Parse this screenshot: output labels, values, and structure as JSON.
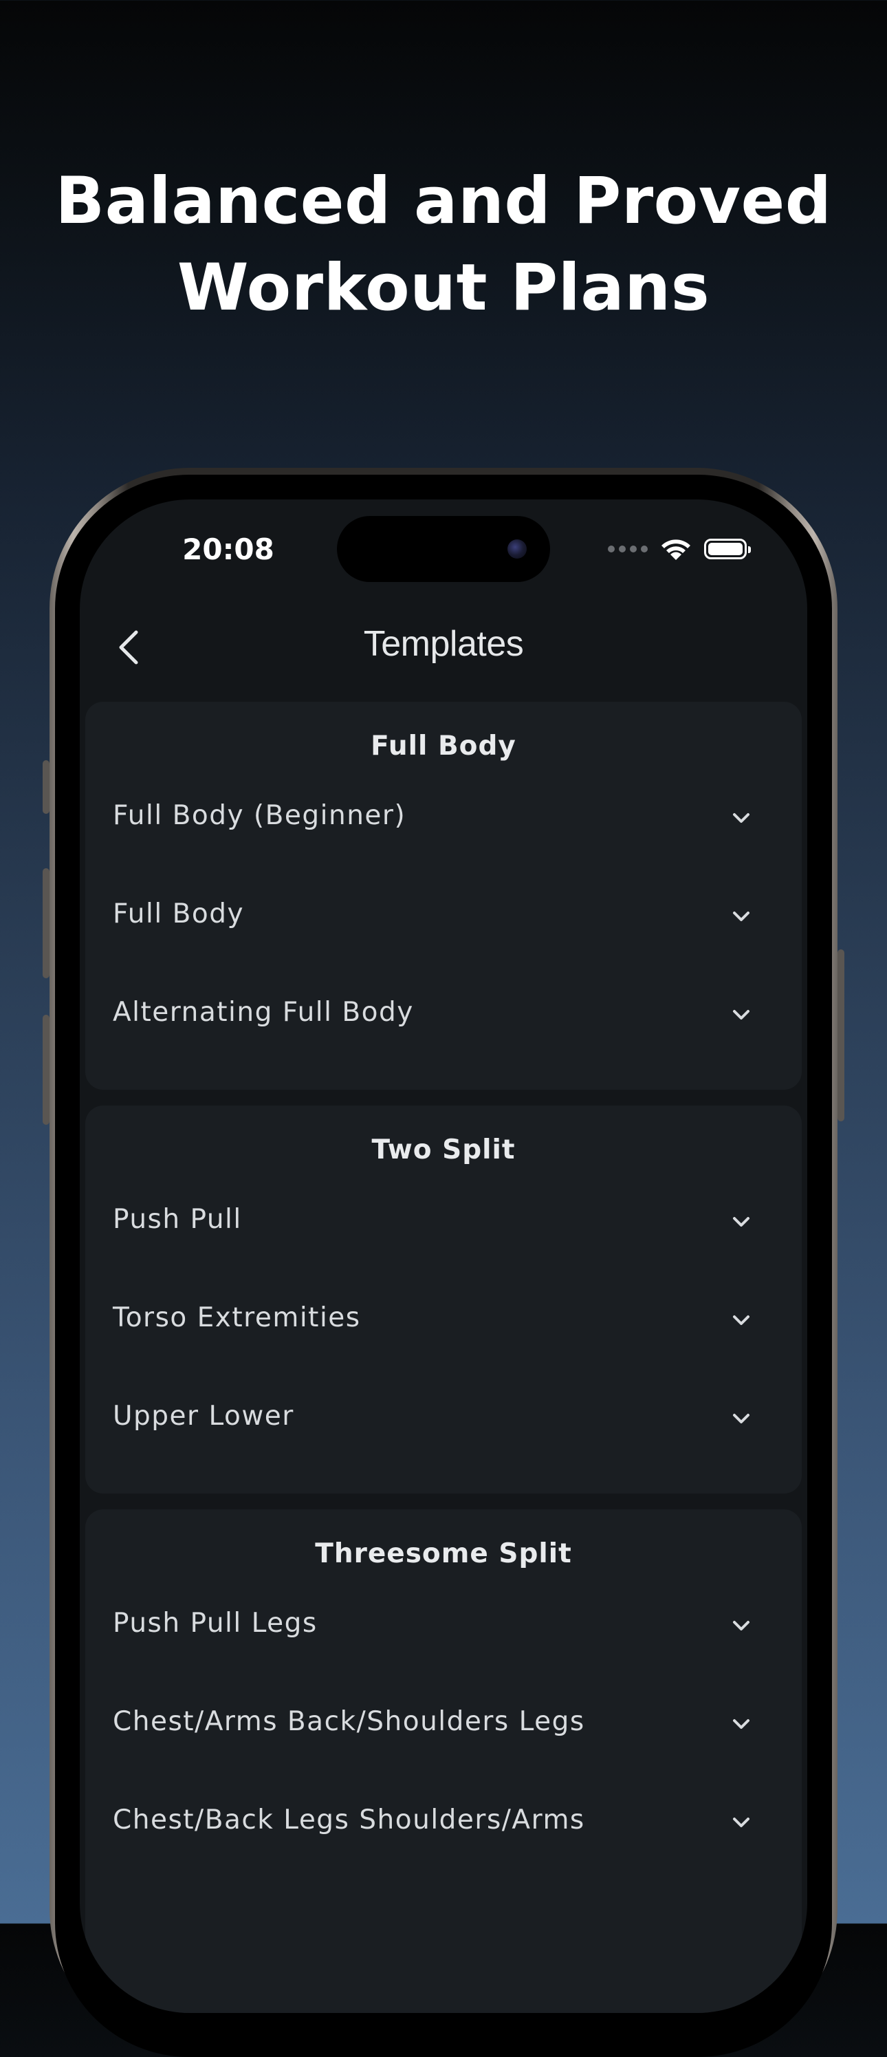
{
  "headline": {
    "line1": "Balanced and Proved",
    "line2": "Workout Plans"
  },
  "status_bar": {
    "time": "20:08"
  },
  "nav": {
    "title": "Templates",
    "back_icon": "chevron-left-icon"
  },
  "sections": [
    {
      "title": "Full Body",
      "items": [
        "Full Body (Beginner)",
        "Full Body",
        "Alternating Full Body"
      ]
    },
    {
      "title": "Two Split",
      "items": [
        "Push Pull",
        "Torso Extremities",
        "Upper Lower"
      ]
    },
    {
      "title": "Threesome Split",
      "items": [
        "Push Pull Legs",
        "Chest/Arms Back/Shoulders Legs",
        "Chest/Back Legs Shoulders/Arms"
      ]
    }
  ],
  "colors": {
    "screen_bg": "#131619",
    "card_bg": "#1a1e22",
    "text": "#d9dcdf"
  }
}
